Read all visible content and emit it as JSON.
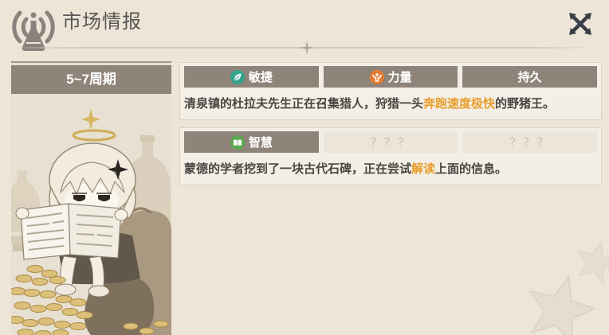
{
  "header": {
    "title": "市场情报",
    "app_icon": "market-intel-signal-flask-icon",
    "close_icon": "close-icon",
    "divider_icon": "sparkle-icon"
  },
  "period": {
    "label": "5~7周期"
  },
  "intel_cards": [
    {
      "tags": [
        {
          "label": "敏捷",
          "icon": "leaf-icon",
          "icon_color": "#35a48b",
          "revealed": true
        },
        {
          "label": "力量",
          "icon": "strength-icon",
          "icon_color": "#e67a2f",
          "revealed": true
        },
        {
          "label": "持久",
          "revealed": true
        }
      ],
      "description": {
        "before": "清泉镇的杜拉夫先生正在召集猎人，狩猎一头",
        "highlight": "奔跑速度极快",
        "after": "的野猪王。"
      }
    },
    {
      "tags": [
        {
          "label": "智慧",
          "icon": "book-icon",
          "icon_color": "#5aa94e",
          "revealed": true
        },
        {
          "label": "？？？",
          "revealed": false
        },
        {
          "label": "？？？",
          "revealed": false
        }
      ],
      "description": {
        "before": "蒙德的学者挖到了一块古代石碑，正在尝试",
        "highlight": "解读",
        "after": "上面的信息。"
      }
    }
  ],
  "colors": {
    "page_background": "#ece5d8",
    "tag_background": "#8e8479",
    "tag_hidden_background": "#ebe5da",
    "text": "#4a4541",
    "highlight": "#e89e2c",
    "icon_grey": "#8a837d"
  }
}
